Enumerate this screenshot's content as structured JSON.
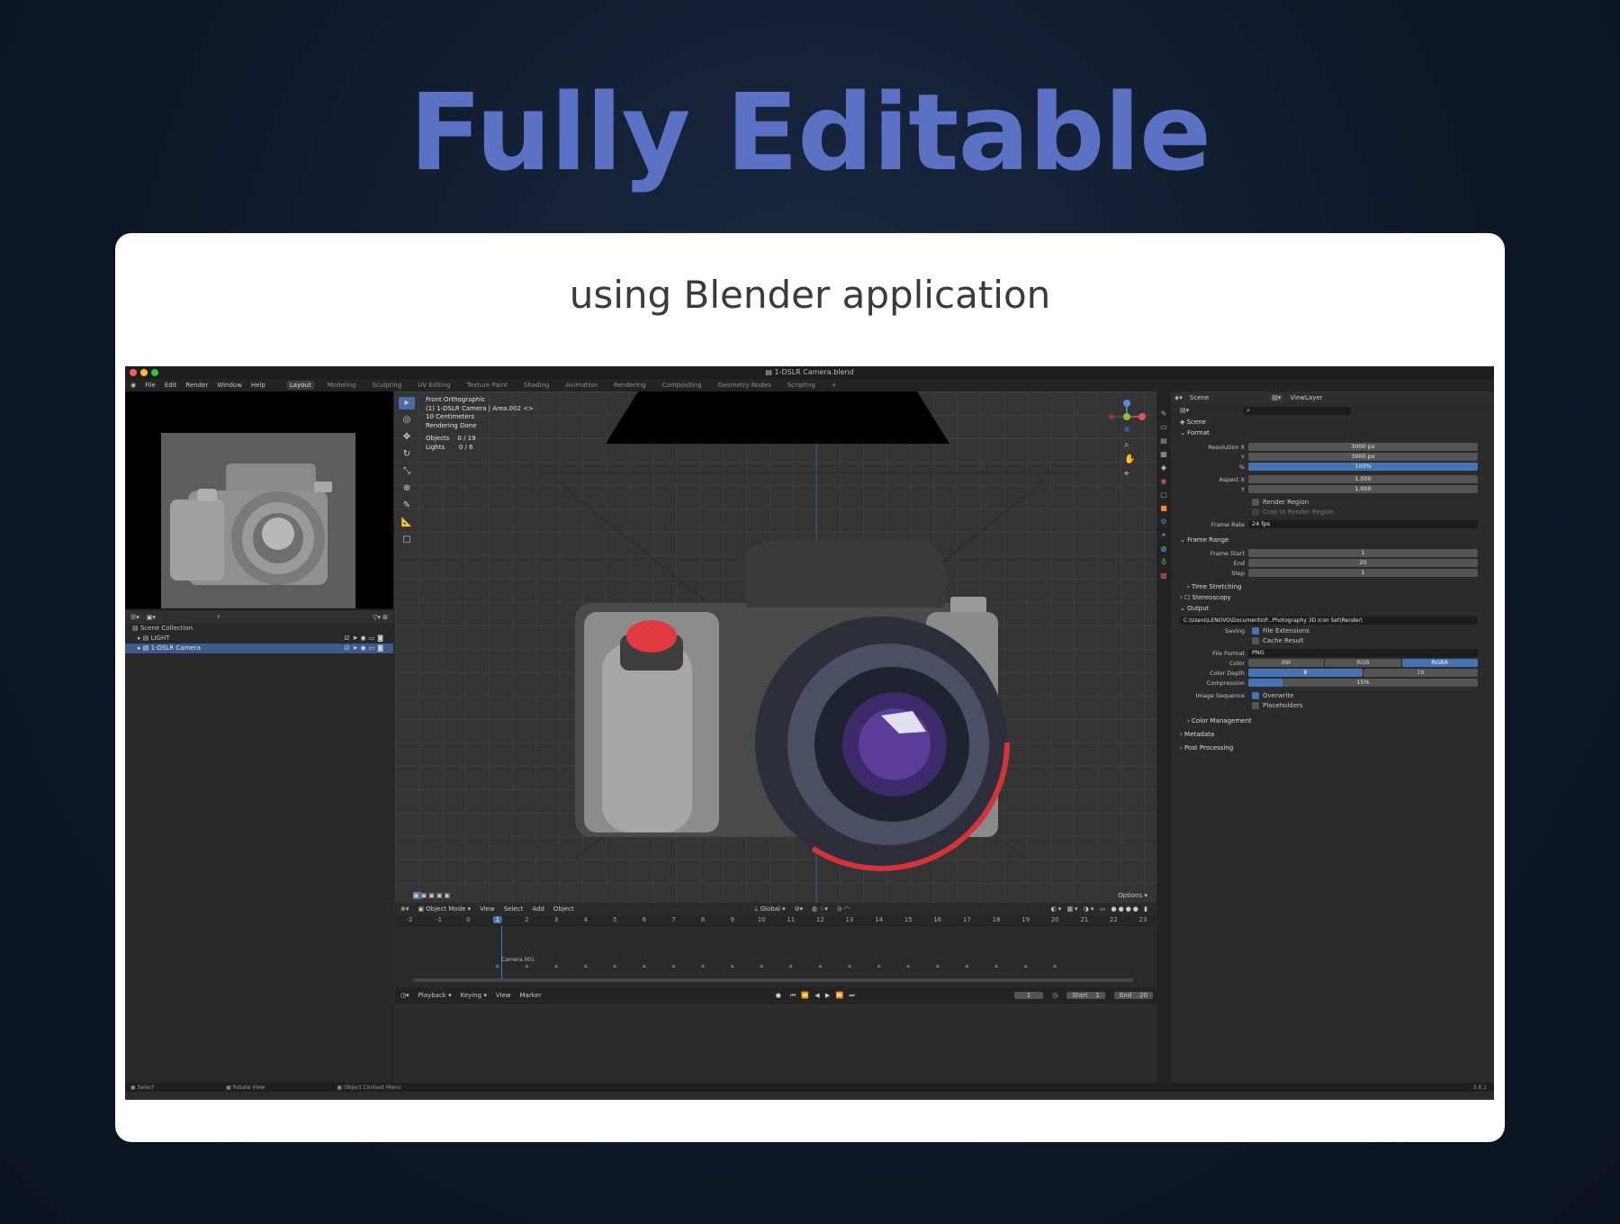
{
  "headline": "Fully Editable",
  "subtitle": "using Blender application",
  "app": {
    "window_title": "1-DSLR Camera.blend",
    "menu": [
      "File",
      "Edit",
      "Render",
      "Window",
      "Help"
    ],
    "workspaces": [
      "Layout",
      "Modeling",
      "Sculpting",
      "UV Editing",
      "Texture Paint",
      "Shading",
      "Animation",
      "Rendering",
      "Compositing",
      "Geometry Nodes",
      "Scripting"
    ],
    "active_workspace": "Layout",
    "viewport_info": {
      "view": "Front Orthographic",
      "object": "(1) 1-DSLR Camera | Area.002 <>",
      "scale": "10 Centimeters",
      "status": "Rendering Done",
      "objects_label": "Objects",
      "objects_value": "0 / 19",
      "lights_label": "Lights",
      "lights_value": "0 / 6"
    },
    "outliner": {
      "collection": "Scene Collection",
      "items": [
        {
          "name": "LIGHT",
          "selected": false
        },
        {
          "name": "1-DSLR Camera",
          "selected": true
        }
      ]
    },
    "viewport_header": {
      "mode": "Object Mode",
      "menus": [
        "View",
        "Select",
        "Add",
        "Object"
      ],
      "transform": "Global",
      "options": "Options"
    },
    "timeline": {
      "frames": [
        "-2",
        "-1",
        "0",
        "1",
        "2",
        "3",
        "4",
        "5",
        "6",
        "7",
        "8",
        "9",
        "10",
        "11",
        "12",
        "13",
        "14",
        "15",
        "16",
        "17",
        "18",
        "19",
        "20",
        "21",
        "22",
        "23"
      ],
      "current_frame": "1",
      "marker": "Camera.001",
      "menus": [
        "Playback",
        "Keying",
        "View",
        "Marker"
      ],
      "frame_value": "1",
      "start_label": "Start",
      "start": "1",
      "end_label": "End",
      "end": "20"
    },
    "status_bar": [
      "Select",
      "Rotate View",
      "Object Context Menu"
    ],
    "version": "3.6.1",
    "properties": {
      "scene_label": "Scene",
      "viewlayer_label": "ViewLayer",
      "context": "Scene",
      "format_label": "Format",
      "resolution_x_label": "Resolution X",
      "resolution_x": "3000 px",
      "y_label": "Y",
      "resolution_y": "3000 px",
      "percent_label": "%",
      "percent": "100%",
      "aspect_x_label": "Aspect X",
      "aspect_x": "1.000",
      "aspect_y": "1.000",
      "render_region": "Render Region",
      "crop_region": "Crop to Render Region",
      "frame_rate_label": "Frame Rate",
      "frame_rate": "24 fps",
      "frame_range_label": "Frame Range",
      "frame_start_label": "Frame Start",
      "frame_start": "1",
      "end_label": "End",
      "frame_end": "20",
      "step_label": "Step",
      "step": "1",
      "time_stretching": "Time Stretching",
      "stereoscopy": "Stereoscopy",
      "output_label": "Output",
      "output_path": "C:\\Users\\LENOVO\\Documents\\P...Photography 3D Icon Set\\Render\\",
      "saving_label": "Saving",
      "file_extensions": "File Extensions",
      "cache_result": "Cache Result",
      "file_format_label": "File Format",
      "file_format": "PNG",
      "color_label": "Color",
      "color_options": [
        "BW",
        "RGB",
        "RGBA"
      ],
      "color_active": "RGBA",
      "color_depth_label": "Color Depth",
      "color_depth_options": [
        "8",
        "16"
      ],
      "color_depth_active": "8",
      "compression_label": "Compression",
      "compression": "15%",
      "compression_fraction": 0.15,
      "image_sequence_label": "Image Sequence",
      "overwrite": "Overwrite",
      "placeholders": "Placeholders",
      "color_management": "Color Management",
      "metadata": "Metadata",
      "post_processing": "Post Processing"
    }
  }
}
